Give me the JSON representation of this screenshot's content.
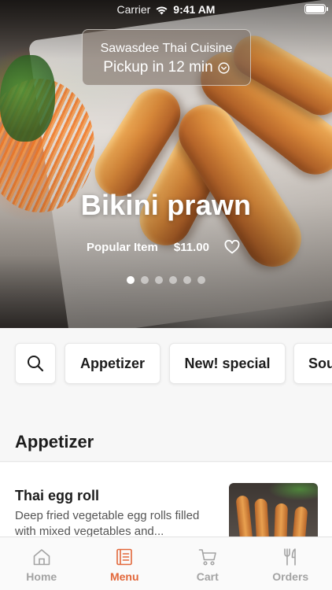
{
  "status_bar": {
    "carrier": "Carrier",
    "time": "9:41 AM"
  },
  "store": {
    "name": "Sawasdee Thai Cuisine",
    "pickup": "Pickup in 12 min"
  },
  "featured": {
    "title": "Bikini prawn",
    "badge": "Popular Item",
    "price": "$11.00",
    "carousel_total": 6,
    "carousel_active": 1
  },
  "categories": {
    "items": [
      "Appetizer",
      "New! special",
      "Sou"
    ]
  },
  "section": {
    "title": "Appetizer",
    "items": [
      {
        "name": "Thai egg roll",
        "description": "Deep fried vegetable egg rolls filled with mixed vegetables and..."
      }
    ]
  },
  "tab_bar": {
    "tabs": [
      {
        "label": "Home",
        "icon": "home-icon"
      },
      {
        "label": "Menu",
        "icon": "menu-book-icon"
      },
      {
        "label": "Cart",
        "icon": "cart-icon"
      },
      {
        "label": "Orders",
        "icon": "fork-knife-icon"
      }
    ],
    "active_index": 1
  },
  "colors": {
    "accent": "#e2673a",
    "inactive": "#a3a3a3"
  }
}
